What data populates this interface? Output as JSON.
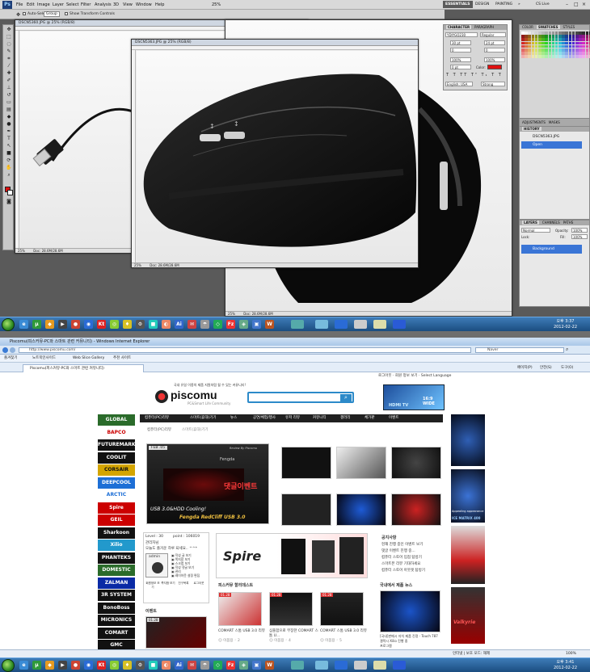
{
  "photoshop": {
    "menu": [
      "File",
      "Edit",
      "Image",
      "Layer",
      "Select",
      "Filter",
      "Analysis",
      "3D",
      "View",
      "Window",
      "Help"
    ],
    "zoom_combo": "25%",
    "workspace": [
      "ESSENTIALS",
      "DESIGN",
      "PAINTING",
      "»"
    ],
    "cs_live": "CS Live",
    "options": {
      "auto_select": "Auto-Select:",
      "auto_select_value": "Group",
      "show_transform": "Show Transform Controls"
    },
    "doc1": {
      "title": "DSCN5360.JPG @ 25% (RGB/8)",
      "zoom": "25%",
      "doc_size": "Doc: 28.6M/28.6M"
    },
    "doc2": {
      "title": "DSCN5363.JPG @ 25% (RGB/8)",
      "zoom": "25%",
      "doc_size": "Doc: 28.6M/28.6M"
    },
    "doc3": {
      "zoom": "25%",
      "doc_size": "Doc: 28.6M/28.6M"
    },
    "character": {
      "tabs": [
        "CHARACTER",
        "PARAGRAPH"
      ],
      "font": "YDIYGO230",
      "style": "Regular",
      "size": "30 pt",
      "leading": "24 pt",
      "tracking": "0",
      "scale_v": "100%",
      "scale_h": "100%",
      "baseline": "0 pt",
      "color_label": "Color:",
      "language": "English: USA",
      "aa": "Strong",
      "kerning": "0"
    },
    "color_panel": {
      "tabs": [
        "COLOR",
        "SWATCHES",
        "STYLES"
      ]
    },
    "adjust_panel": {
      "tabs": [
        "ADJUSTMENTS",
        "MASKS"
      ]
    },
    "history": {
      "tabs": [
        "HISTORY"
      ],
      "snapshot": "DSCN5363.JPG",
      "items": [
        "Open"
      ]
    },
    "layers": {
      "tabs": [
        "LAYERS",
        "CHANNELS",
        "PATHS"
      ],
      "mode": "Normal",
      "opacity_label": "Opacity:",
      "opacity": "100%",
      "lock": "Lock:",
      "fill_label": "Fill:",
      "fill": "100%",
      "items": [
        "Background"
      ]
    },
    "colors": {
      "foreground": "#e01010",
      "background": "#ffffff",
      "selection": "#3a75d6"
    }
  },
  "taskbar_top": {
    "time": "오후 3:37",
    "date": "2012-02-22"
  },
  "taskbar_bottom": {
    "time": "오후 3:41",
    "date": "2012-02-22"
  },
  "browser": {
    "title": "Piscomu(피스커뮤-PC와 스마트 관련 커뮤니티) - Windows Internet Explorer",
    "address": "http://www.piscomu.com/",
    "search_provider": "Naver",
    "fav_label": "즐겨찾기",
    "fav_items": [
      "노트북인사이드",
      "Web Slice Gallery",
      "추천 사이트"
    ],
    "tab_title": "Piscomu(피스커뮤-PC와 스마트 관련 커뮤니티)",
    "toolbar_right": [
      "페이지(P)",
      "안전(S)",
      "도구(O)"
    ],
    "status": {
      "zone": "인터넷 | 보호 모드: 해제",
      "zoom": "100%"
    }
  },
  "site": {
    "top_links": "로그아웃 · 회원 정보 보기 · Select Language",
    "tagline": "국내 유일 이종의 제품 지원처럼 될 수 있는 커뮤니티!",
    "logo": "piscomu",
    "logo_sub": "PC&Smart Life Community",
    "search_placeholder": "",
    "ad_right": "16:9 WIDE",
    "ad_right_brand": "HDMI TV",
    "nav": [
      "컴퓨터(PC)리뷰",
      "스마트(휴대)기기",
      "뉴스",
      "공연/체험/행사",
      "유저 리뷰",
      "커뮤니티",
      "갤러리",
      "체가판",
      "이벤트"
    ],
    "subtabs": [
      "컴퓨터(PC)리뷰",
      "스마트(휴대)기기"
    ],
    "featured": {
      "badge": "FEB .05",
      "review_by": "Review By Piscomu",
      "brand": "Fengda",
      "event": "댓글이벤트",
      "line1": "USB 3.0&HDD Cooling!",
      "line2": "Fengda RedCliff USB 3.0"
    },
    "left_sponsors": [
      "GLOBAL",
      "BAPCO",
      "FUTUREMARK",
      "COOLIT",
      "CORSAIR",
      "DEEPCOOL",
      "ARCTIC",
      "Spire",
      "GEIL",
      "Sharkoon",
      "Xilio",
      "PHANTEKS",
      "DOMESTIC",
      "ZALMAN",
      "3R SYSTEM",
      "BonoBoss",
      "MICRONICS",
      "COMART",
      "GMC"
    ],
    "login": {
      "level": "Level : 30",
      "point": "point : 106019",
      "name": "관리자님",
      "greeting": "오늘도 즐거운 하루 되세요.. ^^*",
      "avatar_label": "admin",
      "links": [
        "작성 글 보기",
        "쪽지함 보기",
        "스크랩 보기",
        "작성 댓글 보기",
        "관리",
        "레이아웃 설정 편집"
      ],
      "buttons": [
        "회원정보 보기",
        "쪽지함 보기",
        "친구목록",
        "로그아웃"
      ]
    },
    "banner_brand": "Spire",
    "notice_title": "공지사항",
    "notices": [
      "현재 진행 중인 이벤트 보기",
      "댓글 이벤트 진행 중...",
      "컴퓨터 스토어 입점 탐방기",
      "스마트폰 리뷰 기대하세요",
      "컴퓨터 스토어 아웃렛 탐방기"
    ],
    "hotnews_title": "국내에서 제품 뉴스",
    "hotnews": [
      "[국내]판매시 자치 제품 진정 - Touch 787",
      "갤럭시 Xilio 진행 중",
      "프로그램"
    ],
    "street_title": "피스커뮤 할리데스트",
    "street_items": [
      {
        "tag": "01.28",
        "title": "COMART 스톰 USB 3.0 리뷰",
        "author": "이봄용",
        "count": "2"
      },
      {
        "tag": "01.28",
        "title": "심플함으로 무장한 COMART 스톰 U...",
        "author": "이봄용",
        "count": "4"
      },
      {
        "tag": "01.28",
        "title": "COMART 스톰 USB 3.0 리뷰",
        "author": "이봄용",
        "count": "5"
      }
    ],
    "event_title": "이벤트",
    "event_tag": "01.28",
    "right_ads": [
      "Appealing appearance",
      "ICE MATRIX 400",
      "Valkyrie"
    ]
  },
  "chart_data": null
}
